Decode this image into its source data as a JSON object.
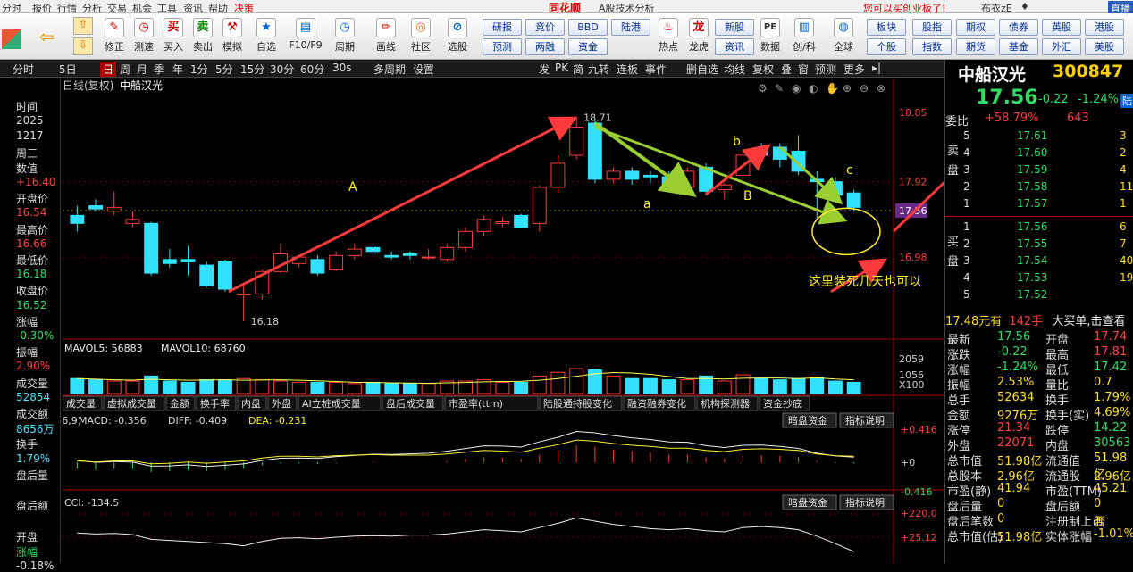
{
  "menu": {
    "items": [
      "分时",
      "报价",
      "行情",
      "分析",
      "交易",
      "机会",
      "工具",
      "资讯",
      "帮助",
      "决策"
    ],
    "brand": "同花顺",
    "subtitle": "A股技术分析",
    "promo": "您可以买创业板了!",
    "user": "布衣zE",
    "live": "直播"
  },
  "toolbar": {
    "items": [
      "修正",
      "测速",
      "买入",
      "卖出",
      "模拟",
      "自选",
      "F10/F9",
      "周期",
      "画线",
      "社区",
      "选股",
      "热点",
      "龙虎",
      "数据",
      "创/科",
      "全球"
    ],
    "small_buttons": [
      "研报",
      "竞价",
      "BBD",
      "陆港",
      "预测",
      "两融",
      "资金",
      "新股",
      "资讯",
      "PE",
      "板块",
      "股指",
      "期权",
      "债券",
      "英股",
      "港股",
      "个股",
      "指数",
      "期货",
      "基金",
      "外汇",
      "美股"
    ]
  },
  "tabs": [
    "分时",
    "5日",
    "日",
    "周",
    "月",
    "季",
    "年",
    "1分",
    "5分",
    "15分",
    "30分",
    "60分",
    "30s",
    "多周期",
    "设置"
  ],
  "tabs_right": [
    "发",
    "PK",
    "简",
    "九转",
    "连板",
    "事件",
    "删自选",
    "均线",
    "复权",
    "叠",
    "窗",
    "预测",
    "更多"
  ],
  "chart": {
    "header": "日线(复权)",
    "name": "中船汉光",
    "price_labels": [
      "18.85",
      "17.92",
      "17.56",
      "16.98"
    ],
    "high_label": "18.71",
    "low_label": "16.18",
    "annot_A": "A",
    "annot_a": "a",
    "annot_B": "B",
    "annot_b": "b",
    "annot_c": "c",
    "annot_note": "这里装死几天也可以",
    "vol_legend": "MAVOL5: 56883",
    "vol_legend2": "MAVOL10: 68760",
    "vol_axis": [
      "2059",
      "1056",
      "X100"
    ],
    "subtabs": [
      "成交量",
      "虚拟成交量",
      "金额",
      "换手率",
      "内盘",
      "外盘",
      "AI立桩成交量",
      "盘后成交量",
      "市盈率(ttm)",
      "陆股通持股变化",
      "融资融券变化",
      "机构探测器",
      "资金抄底"
    ],
    "macd_legend": "(26,9)",
    "macd_val": "MACD: -0.356",
    "diff_val": "DIFF: -0.409",
    "dea_val": "DEA: -0.231",
    "macd_btn1": "暗盘资金",
    "macd_btn2": "指标说明",
    "macd_axis": [
      "+0.416",
      "+0",
      "-0.416"
    ],
    "cci_legend": "CCI: -134.5",
    "cci_btn1": "暗盘资金",
    "cci_btn2": "指标说明",
    "cci_axis": [
      "+220.0",
      "+25.12"
    ]
  },
  "chart_data": {
    "type": "candlestick",
    "title": "中船汉光",
    "ylim": [
      16.18,
      18.85
    ],
    "candles": [
      [
        17.5,
        17.62,
        17.3,
        17.4
      ],
      [
        17.62,
        17.7,
        17.55,
        17.58
      ],
      [
        17.55,
        17.8,
        17.5,
        17.6
      ],
      [
        17.4,
        17.55,
        17.35,
        17.45
      ],
      [
        17.4,
        17.42,
        16.75,
        16.78
      ],
      [
        16.95,
        17.08,
        16.85,
        16.9
      ],
      [
        16.95,
        17.12,
        16.75,
        16.92
      ],
      [
        16.88,
        16.92,
        16.6,
        16.62
      ],
      [
        16.92,
        16.95,
        16.55,
        16.58
      ],
      [
        16.52,
        16.62,
        16.18,
        16.52
      ],
      [
        16.52,
        16.82,
        16.45,
        16.8
      ],
      [
        16.8,
        17.15,
        16.78,
        17.02
      ],
      [
        16.9,
        17.0,
        16.85,
        16.98
      ],
      [
        16.95,
        17.0,
        16.75,
        16.78
      ],
      [
        16.82,
        17.05,
        16.8,
        17.0
      ],
      [
        17.0,
        17.15,
        16.95,
        17.08
      ],
      [
        17.1,
        17.15,
        17.0,
        17.05
      ],
      [
        17.0,
        17.05,
        16.95,
        16.98
      ],
      [
        17.02,
        17.05,
        16.95,
        17.0
      ],
      [
        16.98,
        17.08,
        16.95,
        16.98
      ],
      [
        16.95,
        17.15,
        16.92,
        17.1
      ],
      [
        17.1,
        17.35,
        17.05,
        17.3
      ],
      [
        17.3,
        17.5,
        17.25,
        17.45
      ],
      [
        17.4,
        17.48,
        17.35,
        17.42
      ],
      [
        17.5,
        17.52,
        17.35,
        17.35
      ],
      [
        17.4,
        17.88,
        17.3,
        17.85
      ],
      [
        17.85,
        18.25,
        17.78,
        18.15
      ],
      [
        18.25,
        18.71,
        18.2,
        18.6
      ],
      [
        18.65,
        18.7,
        17.9,
        17.95
      ],
      [
        17.95,
        18.1,
        17.9,
        18.05
      ],
      [
        18.05,
        18.1,
        17.88,
        17.95
      ],
      [
        18.0,
        18.05,
        17.9,
        17.98
      ],
      [
        17.98,
        18.05,
        17.8,
        17.85
      ],
      [
        17.85,
        18.1,
        17.8,
        18.05
      ],
      [
        18.1,
        18.15,
        17.75,
        17.8
      ],
      [
        17.82,
        17.9,
        17.7,
        17.88
      ],
      [
        18.0,
        18.3,
        17.95,
        18.25
      ],
      [
        18.3,
        18.4,
        18.2,
        18.25
      ],
      [
        18.35,
        18.4,
        18.1,
        18.2
      ],
      [
        18.3,
        18.5,
        18.0,
        18.05
      ],
      [
        17.95,
        18.05,
        17.45,
        17.92
      ],
      [
        17.92,
        17.98,
        17.7,
        17.75
      ],
      [
        17.78,
        17.82,
        17.55,
        17.6
      ]
    ],
    "volumes": [
      0.6,
      0.55,
      0.5,
      0.5,
      0.7,
      0.5,
      0.45,
      0.55,
      0.55,
      0.6,
      0.55,
      0.5,
      0.45,
      0.45,
      0.45,
      0.4,
      0.45,
      0.4,
      0.4,
      0.4,
      0.5,
      0.5,
      0.55,
      0.45,
      0.45,
      0.7,
      0.85,
      1.0,
      0.95,
      0.7,
      0.6,
      0.6,
      0.55,
      0.55,
      0.7,
      0.5,
      0.75,
      0.6,
      0.55,
      0.6,
      0.65,
      0.5,
      0.45
    ],
    "macd": [
      -0.1,
      -0.12,
      -0.1,
      -0.1,
      -0.15,
      -0.14,
      -0.12,
      -0.14,
      -0.12,
      -0.1,
      -0.05,
      -0.02,
      -0.02,
      -0.03,
      -0.01,
      0.0,
      0.01,
      0.0,
      0.0,
      0.0,
      0.02,
      0.05,
      0.08,
      0.07,
      0.05,
      0.12,
      0.18,
      0.26,
      0.24,
      0.2,
      0.17,
      0.15,
      0.12,
      0.12,
      0.08,
      0.06,
      0.1,
      0.11,
      0.1,
      0.08,
      0.02,
      -0.01,
      -0.02
    ],
    "cci": [
      40,
      30,
      35,
      25,
      -20,
      -30,
      -40,
      -50,
      -60,
      -80,
      -40,
      -10,
      -5,
      -15,
      0,
      10,
      15,
      10,
      20,
      20,
      30,
      50,
      70,
      60,
      50,
      90,
      130,
      180,
      150,
      120,
      100,
      80,
      70,
      80,
      60,
      50,
      90,
      100,
      90,
      70,
      10,
      -60,
      -134.5
    ]
  },
  "quote": {
    "name": "中船汉光",
    "code": "300847",
    "price": "17.56",
    "change": "-0.22",
    "pct": "-1.24%",
    "badge": "陆",
    "weibi_l": "委比",
    "weibi": "+58.79%",
    "weicha": "643",
    "side_sell": "卖盘",
    "side_buy": "买盘",
    "sells": [
      [
        "5",
        "17.61",
        "3"
      ],
      [
        "4",
        "17.60",
        "2"
      ],
      [
        "3",
        "17.59",
        "4"
      ],
      [
        "2",
        "17.58",
        "11"
      ],
      [
        "1",
        "17.57",
        "1"
      ]
    ],
    "buys": [
      [
        "1",
        "17.56",
        "6"
      ],
      [
        "2",
        "17.55",
        "7"
      ],
      [
        "3",
        "17.54",
        "40"
      ],
      [
        "4",
        "17.53",
        "19"
      ],
      [
        "5",
        "17.52",
        ""
      ]
    ],
    "bigorder": "17.48元有",
    "bigorder2": "142手",
    "bigorder3": "大买单,击查看",
    "stats": [
      [
        "最新",
        "17.56",
        "开盘",
        "17.74"
      ],
      [
        "涨跌",
        "-0.22",
        "最高",
        "17.81"
      ],
      [
        "涨幅",
        "-1.24%",
        "最低",
        "17.42"
      ],
      [
        "振幅",
        "2.53%",
        "量比",
        "0.7"
      ],
      [
        "总手",
        "52634",
        "换手",
        "1.79%"
      ],
      [
        "金额",
        "9276万",
        "换手(实)",
        "4.69%"
      ],
      [
        "涨停",
        "21.34",
        "跌停",
        "14.22"
      ],
      [
        "外盘",
        "22071",
        "内盘",
        "30563"
      ],
      [
        "总市值",
        "51.98亿",
        "流通值",
        "51.98亿"
      ],
      [
        "总股本",
        "2.96亿",
        "流通股",
        "2.96亿"
      ],
      [
        "市盈(静)",
        "41.94",
        "市盈(TTM)",
        "45.21"
      ],
      [
        "盘后量",
        "0",
        "盘后额",
        "0"
      ],
      [
        "盘后笔数",
        "0",
        "注册制上市",
        "否"
      ],
      [
        "总市值(估)",
        "51.98亿",
        "实体涨幅",
        "-1.01%"
      ]
    ]
  },
  "left": {
    "labels": [
      "时间",
      "2025",
      "1217",
      "周三",
      "数值",
      "+16.40",
      "开盘价",
      "16.54",
      "最高价",
      "16.66",
      "最低价",
      "16.18",
      "收盘价",
      "16.52",
      "涨幅",
      "-0.30%",
      "振幅",
      "2.90%",
      "成交量",
      "52854",
      "成交额",
      "8656万",
      "换手",
      "1.79%",
      "盘后量",
      "",
      "盘后额",
      "",
      "开盘",
      "涨幅",
      "-0.18%"
    ]
  },
  "colors": {
    "up": "#ff3d3d",
    "down": "#33e0ff",
    "bg": "#000000",
    "ma": "#ffff55"
  }
}
